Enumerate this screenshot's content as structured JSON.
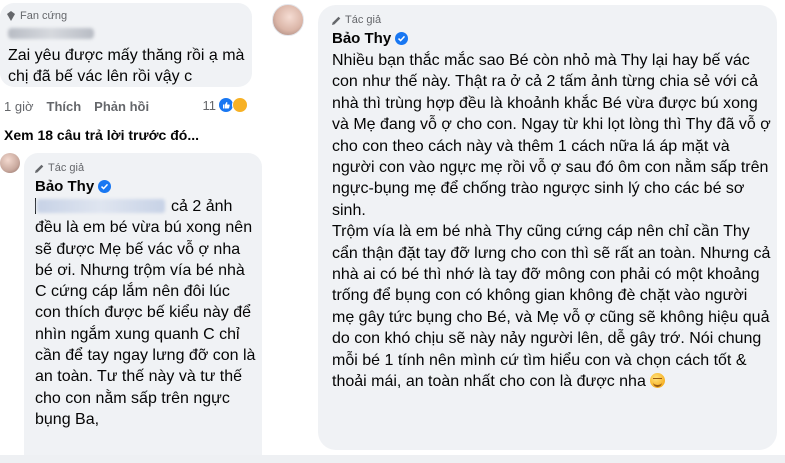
{
  "left": {
    "top_comment": {
      "badge": "Fan cứng",
      "text": "Zai yêu được mấy thăng rồi ạ mà chị đã bế vác lên rồi vậy c"
    },
    "actions": {
      "time": "1 giờ",
      "like": "Thích",
      "reply": "Phản hồi",
      "reaction_count": "11"
    },
    "view_more": "Xem 18 câu trả lời trước đó...",
    "reply": {
      "badge": "Tác giả",
      "author": "Bảo Thy",
      "text_after_mention": "cả 2 ảnh đều là em bé vừa bú xong nên sẽ được Mẹ bế vác vỗ ợ nha bé ơi. Nhưng trộm vía bé nhà C cứng cáp lắm nên đôi lúc con thích được bế kiểu này để nhìn ngắm xung quanh C chỉ cần để tay ngay lưng đỡ con là an toàn. Tư thế này và tư thế cho con nằm sấp trên ngực bụng Ba,"
    }
  },
  "right": {
    "badge": "Tác giả",
    "author": "Bảo Thy",
    "paragraph1": "Nhiều bạn thắc mắc sao Bé còn nhỏ mà Thy lại hay bế vác con như thế này. Thật ra ở cả 2 tấm ảnh từng chia sẻ với cả nhà thì trùng hợp đều là khoảnh khắc Bé vừa được bú xong và Mẹ đang vỗ ợ cho con. Ngay từ khi lọt lòng thì Thy đã vỗ ợ cho con theo cách này và thêm 1 cách nữa lá áp mặt và người con vào ngực mẹ rồi vỗ ợ sau đó ôm con nằm sấp trên ngực-bụng mẹ để chống trào ngược sinh lý cho các bé sơ sinh.",
    "paragraph2": "Trộm vía là em bé nhà Thy cũng cứng cáp nên chỉ cần Thy cẩn thận đặt tay đỡ lưng cho con thì sẽ rất an toàn. Nhưng cả nhà ai có bé thì nhớ là tay đỡ mông con phải có một khoảng trống để bụng con có không gian không đè chặt vào người mẹ gây tức bụng cho Bé, và Mẹ vỗ ợ cũng sẽ không hiệu quả do con khó chịu sẽ này nảy người lên, dễ gây trớ. Nói chung mỗi bé 1 tính nên mình cứ tìm hiểu con và chọn cách tốt & thoải mái, an toàn nhất cho con là được nha"
  },
  "colors": {
    "bubble": "#f0f2f5",
    "meta_text": "#65676b",
    "verified": "#1877f2"
  },
  "icons": [
    "fan-badge-icon",
    "author-pen-icon",
    "verified-icon",
    "like-reaction-icon",
    "haha-reaction-icon",
    "smile-emoji-icon"
  ]
}
